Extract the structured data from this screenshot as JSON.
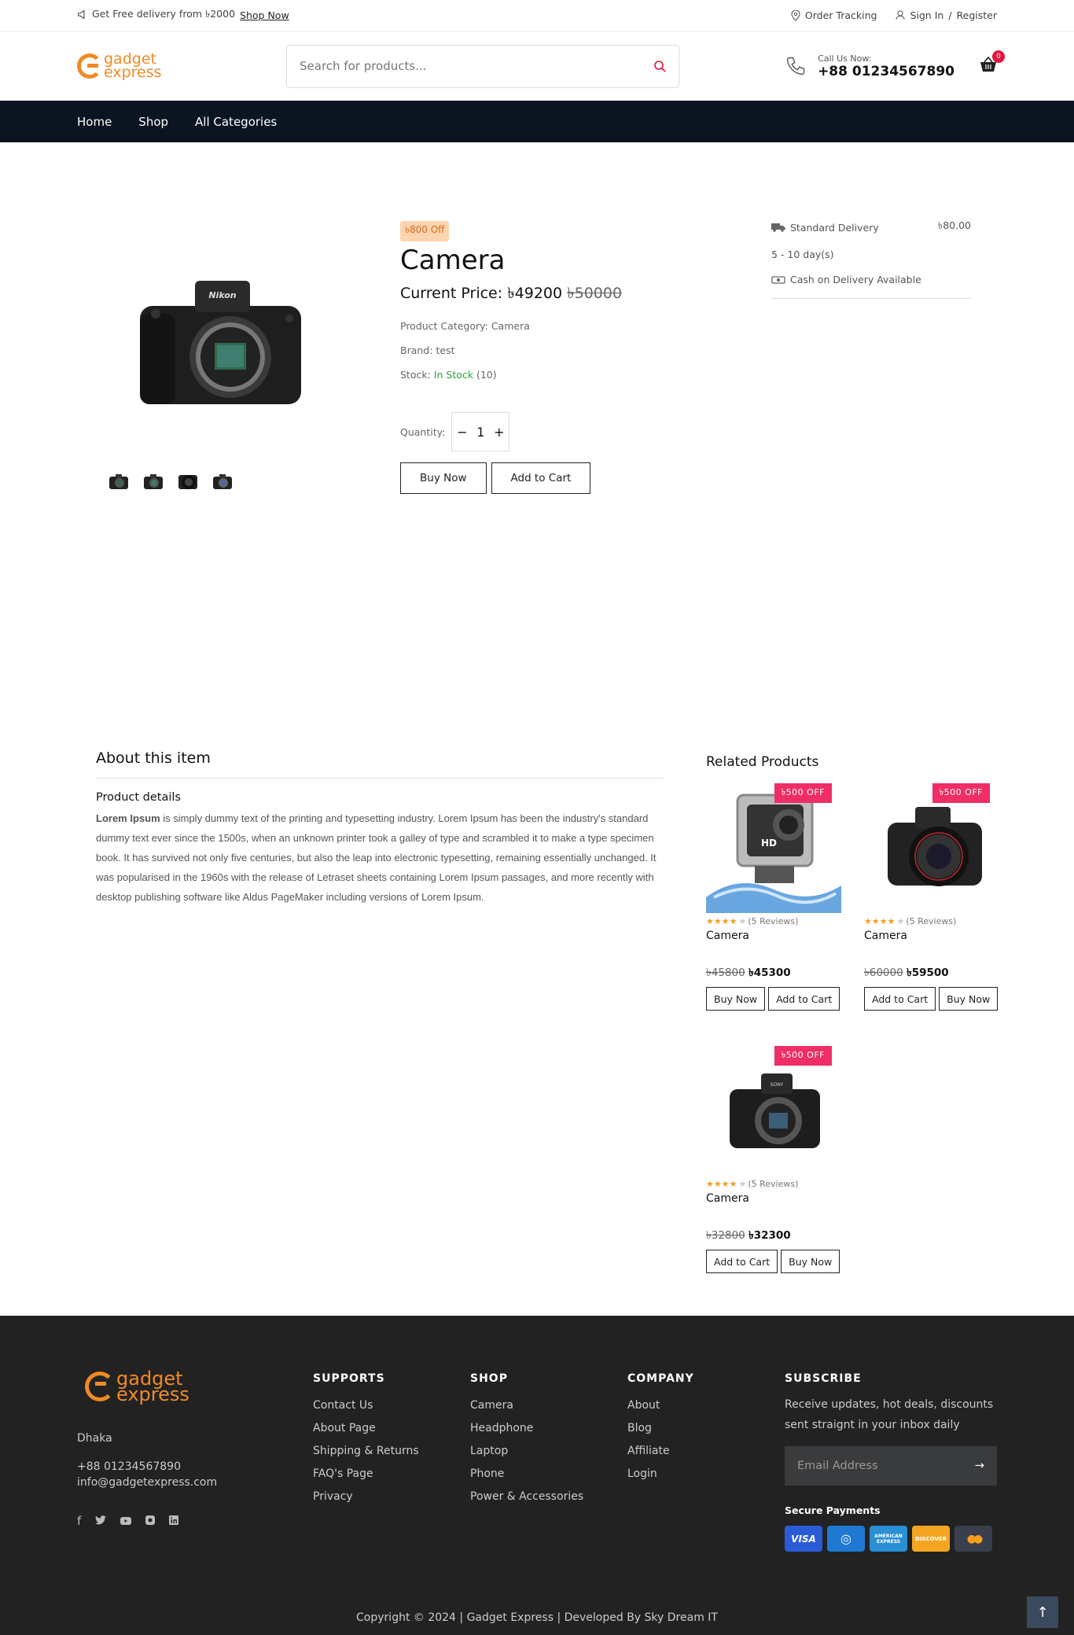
{
  "topbar": {
    "promo": "Get Free delivery from ৳2000",
    "shop_now": "Shop Now",
    "order_tracking": "Order Tracking",
    "sign_in": "Sign In",
    "sep": "/",
    "register": "Register"
  },
  "header": {
    "logo_line1": "gadget",
    "logo_line2": "express",
    "search_placeholder": "Search for products...",
    "call_label": "Call Us Now:",
    "call_number": "+88 01234567890",
    "cart_count": "0"
  },
  "nav": [
    "Home",
    "Shop",
    "All Categories"
  ],
  "product": {
    "off_badge": "৳800 Off",
    "title": "Camera",
    "price_label": "Current Price:",
    "price": "৳49200",
    "old_price": "৳50000",
    "category_label": "Product Category:",
    "category": "Camera",
    "brand_label": "Brand:",
    "brand": "test",
    "stock_label": "Stock:",
    "stock_status": "In Stock",
    "stock_count": "(10)",
    "quantity_label": "Quantity:",
    "quantity": "1",
    "buy_now": "Buy Now",
    "add_to_cart": "Add to Cart"
  },
  "delivery": {
    "standard_label": "Standard Delivery",
    "standard_price": "৳80.00",
    "days": "5 - 10 day(s)",
    "cod": "Cash on Delivery Available"
  },
  "about": {
    "title": "About this item",
    "subtitle": "Product details",
    "lead": "Lorem Ipsum",
    "body": " is simply dummy text of the printing and typesetting industry. Lorem Ipsum has been the industry's standard dummy text ever since the 1500s, when an unknown printer took a galley of type and scrambled it to make a type specimen book. It has survived not only five centuries, but also the leap into electronic typesetting, remaining essentially unchanged. It was popularised in the 1960s with the release of Letraset sheets containing Lorem Ipsum passages, and more recently with desktop publishing software like Aldus PageMaker including versions of Lorem Ipsum."
  },
  "related": {
    "title": "Related Products",
    "items": [
      {
        "tag": "৳500 OFF",
        "rating": 4,
        "reviews": "(5 Reviews)",
        "name": "Camera",
        "old_price": "৳45800",
        "price": "৳45300",
        "btn1": "Buy Now",
        "btn2": "Add to Cart",
        "image": "action-camera"
      },
      {
        "tag": "৳500 OFF",
        "rating": 4,
        "reviews": "(5 Reviews)",
        "name": "Camera",
        "old_price": "৳60000",
        "price": "৳59500",
        "btn1": "Add to Cart",
        "btn2": "Buy Now",
        "image": "dslr-camera"
      },
      {
        "tag": "৳500 OFF",
        "rating": 4,
        "reviews": "(5 Reviews)",
        "name": "Camera",
        "old_price": "৳32800",
        "price": "৳32300",
        "btn1": "Add to Cart",
        "btn2": "Buy Now",
        "image": "mirrorless-camera"
      }
    ]
  },
  "footer": {
    "logo_line1": "gadget",
    "logo_line2": "express",
    "city": "Dhaka",
    "phone": "+88 01234567890",
    "email": "info@gadgetexpress.com",
    "supports": {
      "title": "SUPPORTS",
      "links": [
        "Contact Us",
        "About Page",
        "Shipping & Returns",
        "FAQ's Page",
        "Privacy"
      ]
    },
    "shop": {
      "title": "SHOP",
      "links": [
        "Camera",
        "Headphone",
        "Laptop",
        "Phone",
        "Power & Accessories"
      ]
    },
    "company": {
      "title": "COMPANY",
      "links": [
        "About",
        "Blog",
        "Affiliate",
        "Login"
      ]
    },
    "subscribe": {
      "title": "SUBSCRIBE",
      "text": "Receive updates, hot deals, discounts sent straignt in your inbox daily",
      "email_placeholder": "Email Address",
      "secure": "Secure Payments",
      "payments": [
        "VISA",
        "◎",
        "AMERICAN EXPRESS",
        "DISCOVER",
        "●●"
      ]
    },
    "copyright": "Copyright © 2024 | Gadget Express | Developed By Sky Dream IT"
  },
  "colors": {
    "brand": "#f08a24",
    "nav_bg": "#0b1522",
    "footer_bg": "#222223",
    "sale": "#ef2d66",
    "stock": "#2aa33a"
  }
}
